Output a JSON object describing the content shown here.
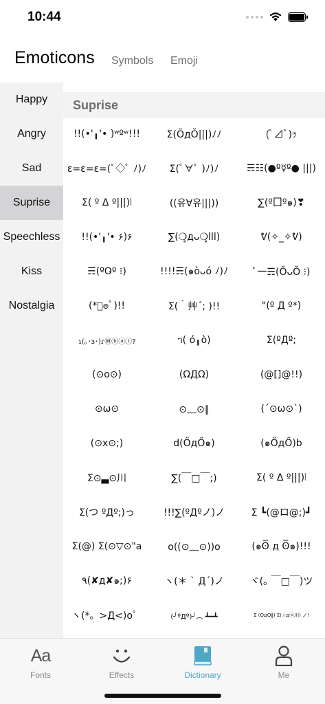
{
  "status": {
    "time": "10:44"
  },
  "header": {
    "title": "Emoticons",
    "tabs": [
      "Symbols",
      "Emoji"
    ]
  },
  "sidebar": {
    "items": [
      {
        "label": "Happy"
      },
      {
        "label": "Angry"
      },
      {
        "label": "Sad"
      },
      {
        "label": "Suprise",
        "active": true
      },
      {
        "label": "Speechless"
      },
      {
        "label": "Kiss"
      },
      {
        "label": "Nostalgia"
      }
    ]
  },
  "content": {
    "section_title": "Suprise",
    "emoticons": [
      "!!(•'╻'• )ʷºʷ!!!",
      "Σ(ŎдŎ|||)ﾉﾉ",
      "(ﾟ⊿ﾟ)ｯ",
      "ε=ε=ε=(ﾟ◇ﾟ ﾉ)ﾉ",
      "Σ(ﾟ∀ﾟ )ﾉ)ﾉ",
      "☴☷(●º☿º● |||)",
      "Σ( º Δ º|||)⦚",
      "((유∀유|||))",
      "∑(º囗º๑)❣",
      "!!(•'╻'• ۶)۶",
      "∑(❍̥дᴗ❍̥lll)",
      "ᕓ(✧_✧ᕓ)",
      "☴(ºO̵º ⁝)",
      "!!!!☴(๑òᴗó ﾉ)ﾉ",
      "ﾟ一☴(ŎᴗŎ ⁝)",
      "(*ﾟ๏ﾟ)!!",
      "Σ(｀艸´; )!!",
      "\"(º Д º*)",
      "ɿ(｡･ɜ･)ɾⓌⓗⓐⓣ?",
      "ᥐ( ό╻ὸ)",
      "Σ(ºДº;",
      "(⊙o⊙)",
      "(ΩДΩ)",
      "(@[]@!!)",
      "⊙ω⊙",
      "⊙﹏⊙∥",
      "(´⊙ω⊙`)",
      "(⊙x⊙;)",
      "d(ŐдŐ๑)",
      "(๑ŐдŐ)b",
      "Σ⊙▃⊙川",
      "∑(￣□￣;)",
      "Σ( º Δ º|||)⦚",
      "Σ(つ ºДº;)っ",
      "!!!∑(ºДºノ)ノ",
      "Σ ┗(@ロ@;)┛",
      "Σ(@) Σ(⊙▽⊙\"a",
      "o((⊙﹏⊙))o",
      "(๑ʘ̅ д ʘ̅๑)!!!",
      "٩(✘д✘๑;)۶",
      "ヽ(＊ ` Д´)ノ",
      "ヾ(｡ ￣□￣)ツ",
      "ヽ(*。>Д<)o゜",
      "(╯ºДº)╯︵ ┻━┻",
      "Σ (OдO‖) Σ(☆дⓞ川) ノ!"
    ]
  },
  "tabbar": {
    "items": [
      {
        "label": "Fonts",
        "glyph": "Aa",
        "icon": "font-icon"
      },
      {
        "label": "Effects",
        "icon": "smile-icon"
      },
      {
        "label": "Dictionary",
        "icon": "book-icon",
        "active": true
      },
      {
        "label": "Me",
        "icon": "person-icon"
      }
    ]
  },
  "colors": {
    "accent": "#4fa6c7",
    "sidebar_bg": "#f2f2f2",
    "sidebar_active": "#d4d4d6"
  }
}
